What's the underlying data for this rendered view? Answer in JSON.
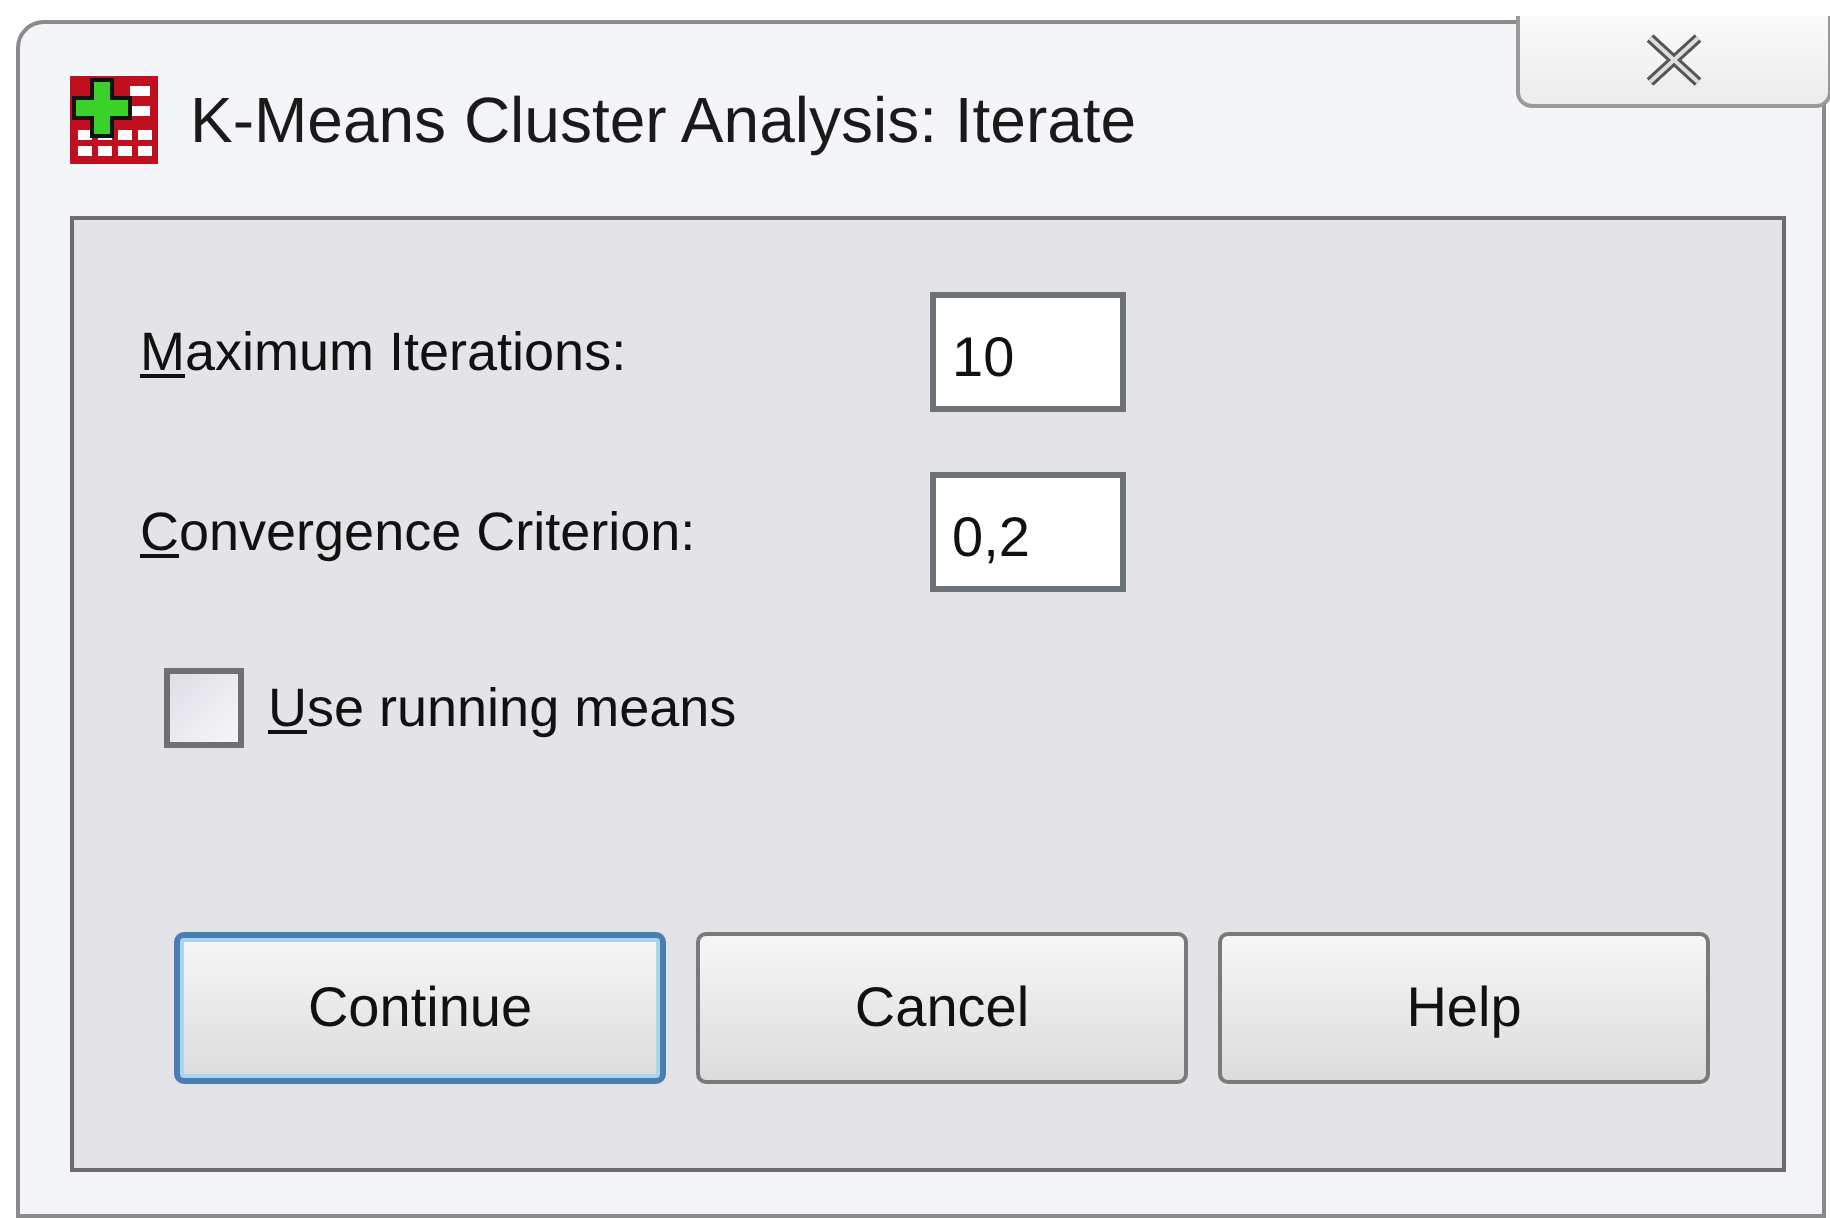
{
  "window": {
    "title": "K-Means Cluster Analysis: Iterate"
  },
  "fields": [
    {
      "label": "Maximum Iterations:",
      "value": "10"
    },
    {
      "label": "Convergence Criterion:",
      "value": "0,2"
    }
  ],
  "checkbox": {
    "label": "Use running means",
    "checked": false
  },
  "buttons": [
    {
      "label": "Continue",
      "default": true
    },
    {
      "label": "Cancel",
      "default": false
    },
    {
      "label": "Help",
      "default": false
    }
  ]
}
